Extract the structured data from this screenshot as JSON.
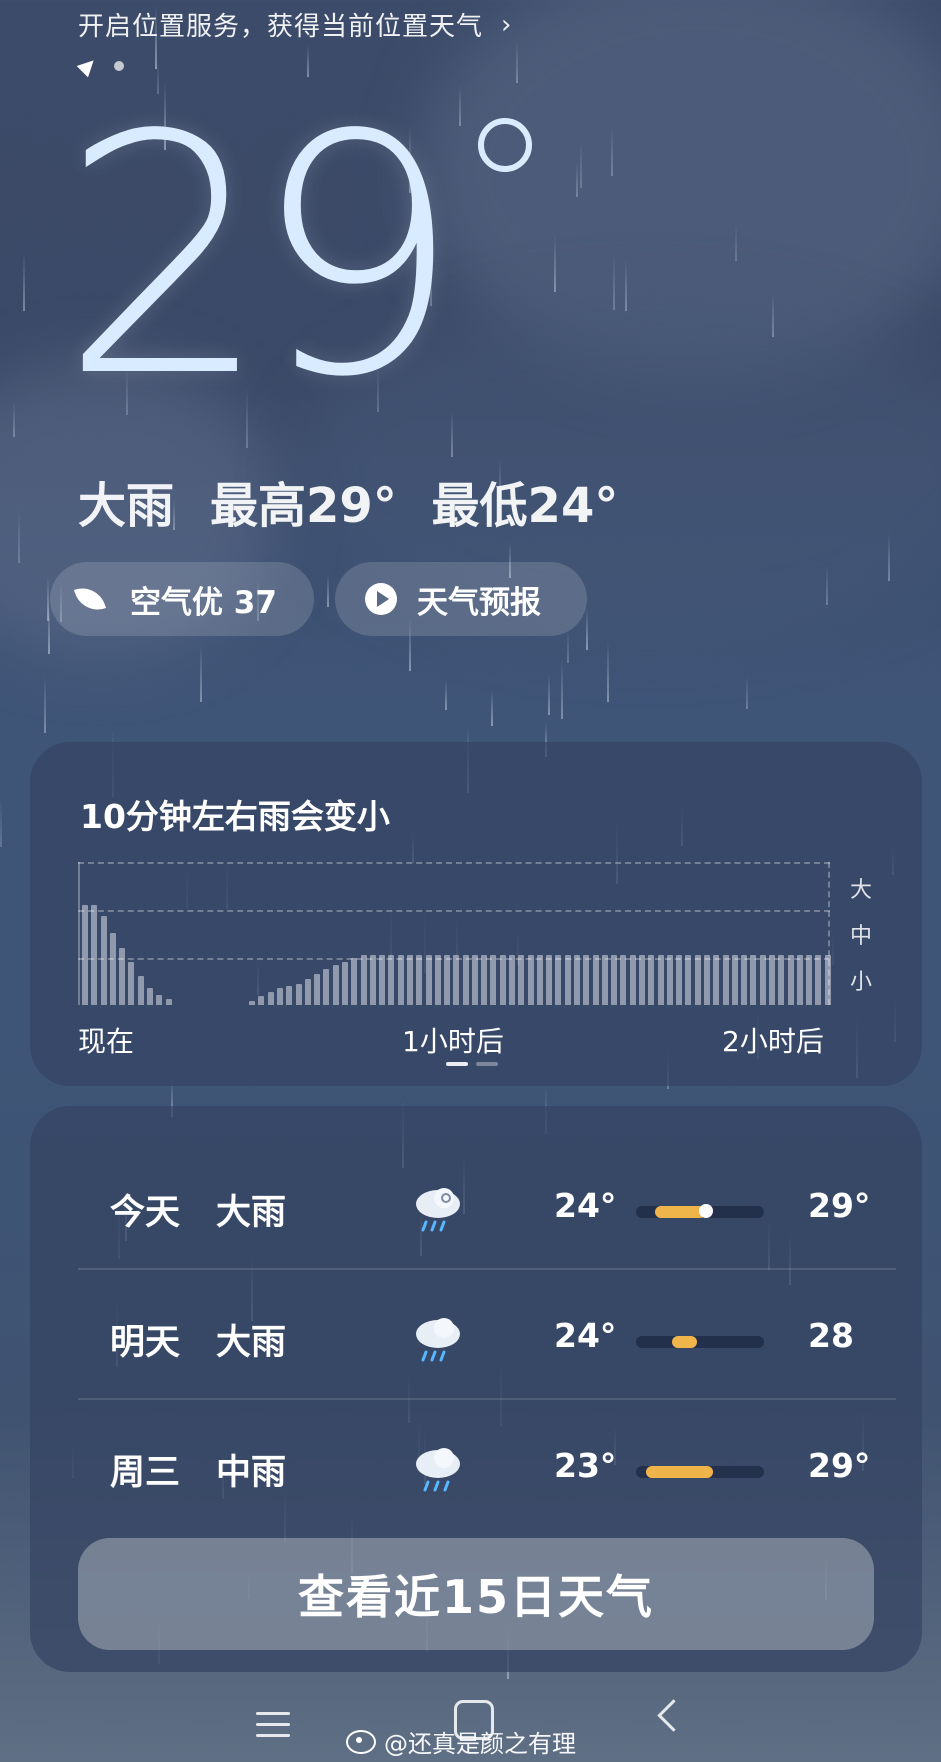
{
  "location_banner": {
    "text": "开启位置服务，获得当前位置天气",
    "chevron": "›"
  },
  "current": {
    "temperature": "29",
    "condition": "大雨",
    "high": "最高29°",
    "low": "最低24°"
  },
  "pills": {
    "air_quality": "空气优 37",
    "forecast_video": "天气预报"
  },
  "precipitation": {
    "title": "10分钟左右雨会变小",
    "levels": [
      "大",
      "中",
      "小"
    ],
    "time_labels": [
      "现在",
      "1小时后",
      "2小时后"
    ],
    "intensity": [
      0.7,
      0.7,
      0.62,
      0.5,
      0.4,
      0.3,
      0.2,
      0.12,
      0.07,
      0.04,
      0,
      0,
      0,
      0,
      0,
      0,
      0,
      0,
      0.03,
      0.06,
      0.09,
      0.12,
      0.13,
      0.15,
      0.18,
      0.22,
      0.25,
      0.28,
      0.3,
      0.33,
      0.35,
      0.35,
      0.35,
      0.35,
      0.35,
      0.35,
      0.35,
      0.35,
      0.35,
      0.35,
      0.35,
      0.35,
      0.35,
      0.35,
      0.35,
      0.35,
      0.35,
      0.35,
      0.35,
      0.35,
      0.35,
      0.35,
      0.35,
      0.35,
      0.35,
      0.35,
      0.35,
      0.35,
      0.35,
      0.35,
      0.35,
      0.35,
      0.35,
      0.35,
      0.35,
      0.35,
      0.35,
      0.35,
      0.35,
      0.35,
      0.35,
      0.35,
      0.35,
      0.35,
      0.35,
      0.35,
      0.35,
      0.35,
      0.35,
      0.35,
      0.35
    ]
  },
  "forecast": [
    {
      "day": "今天",
      "condition": "大雨",
      "icon": "heavy-rain-icon",
      "low": "24°",
      "high": "29°",
      "range_start": 0.15,
      "range_end": 0.55,
      "current": 0.55
    },
    {
      "day": "明天",
      "condition": "大雨",
      "icon": "heavy-rain-icon",
      "low": "24°",
      "high": "28",
      "range_start": 0.28,
      "range_end": 0.48,
      "current": null
    },
    {
      "day": "周三",
      "condition": "中雨",
      "icon": "moderate-rain-icon",
      "low": "23°",
      "high": "29°",
      "range_start": 0.08,
      "range_end": 0.6,
      "current": null
    }
  ],
  "button_15day": "查看近15日天气",
  "watermark": "@还真是颜之有理",
  "colors": {
    "range_fill": "#f0b54a",
    "big_temp": "#d9ebff"
  }
}
